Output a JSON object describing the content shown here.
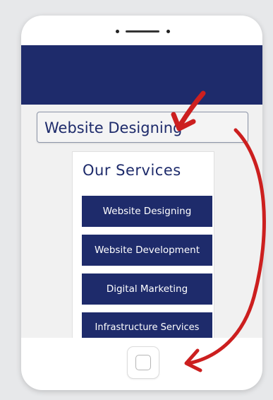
{
  "dropdown": {
    "selected": "Website Designing"
  },
  "services": {
    "title": "Our Services",
    "items": [
      {
        "label": "Website Designing"
      },
      {
        "label": "Website Development"
      },
      {
        "label": "Digital Marketing"
      },
      {
        "label": "Infrastructure Services"
      }
    ]
  },
  "colors": {
    "brand_navy": "#1e2b6b",
    "annotation_red": "#cc1f1f",
    "background": "#e7e8ea"
  },
  "icons": {
    "home": "home-button-icon",
    "camera": "camera-dot-icon",
    "speaker": "speaker-icon",
    "annotation": "red-arrow-icon"
  }
}
